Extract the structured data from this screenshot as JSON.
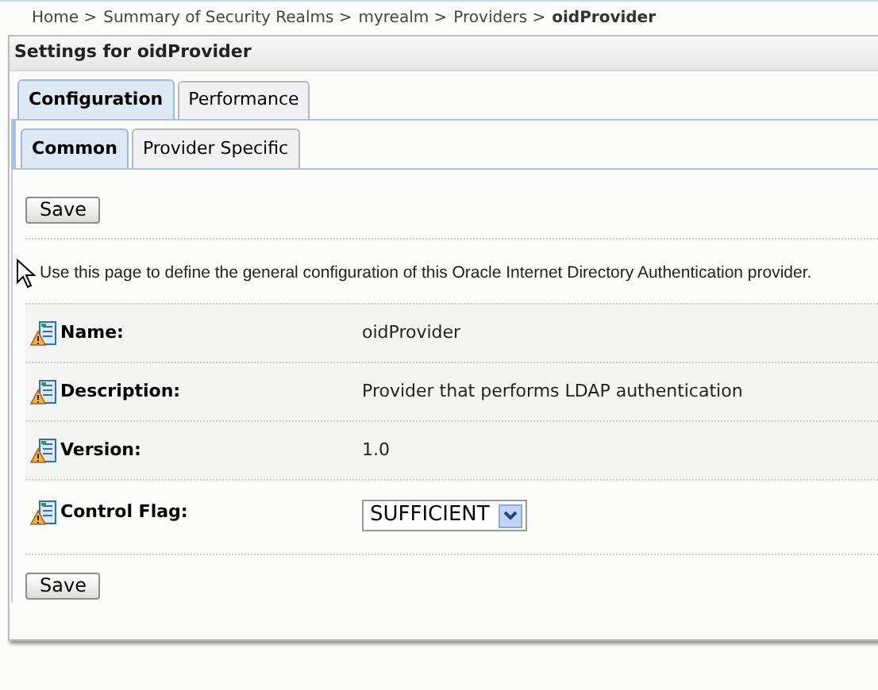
{
  "breadcrumb": [
    {
      "label": "Home >",
      "current": false
    },
    {
      "label": "Summary of Security Realms >",
      "current": false
    },
    {
      "label": "myrealm >",
      "current": false
    },
    {
      "label": "Providers >",
      "current": false
    },
    {
      "label": "oidProvider",
      "current": true
    }
  ],
  "panel": {
    "title": "Settings for oidProvider"
  },
  "tabs": [
    {
      "label": "Configuration",
      "selected": true
    },
    {
      "label": "Performance",
      "selected": false
    }
  ],
  "subtabs": [
    {
      "label": "Common",
      "selected": true
    },
    {
      "label": "Provider Specific",
      "selected": false
    }
  ],
  "save_buttons": [
    "Save",
    "Save"
  ],
  "intro": "Use this page to define the general configuration of this Oracle Internet Directory Authentication provider.",
  "fields": [
    {
      "kind": "text",
      "label": "Name:",
      "value": "oidProvider"
    },
    {
      "kind": "text",
      "label": "Description:",
      "value": "Provider that performs LDAP authentication"
    },
    {
      "kind": "text",
      "label": "Version:",
      "value": "1.0"
    },
    {
      "kind": "select",
      "label": "Control Flag:",
      "value": "SUFFICIENT"
    }
  ]
}
